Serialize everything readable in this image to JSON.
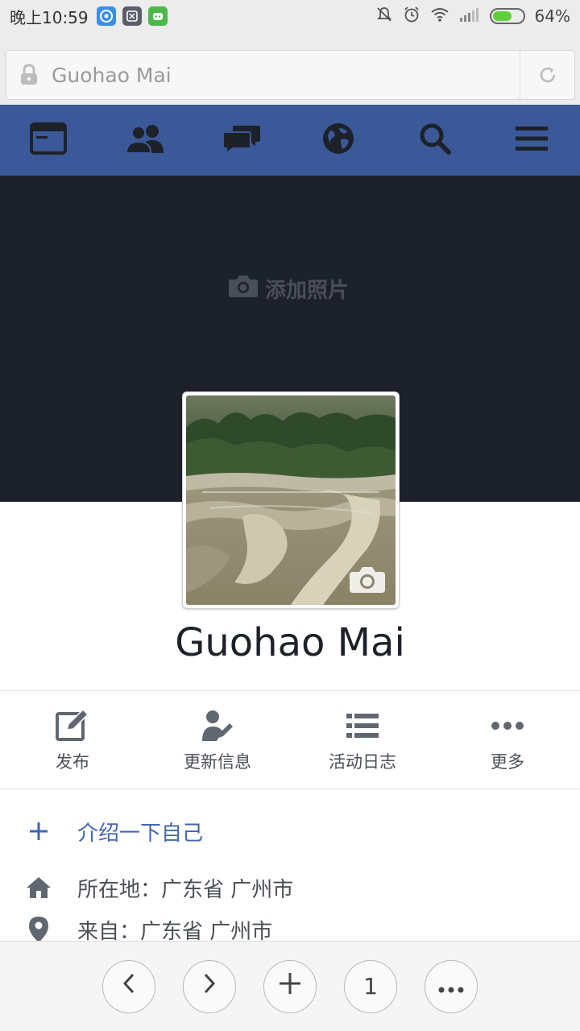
{
  "status_bar": {
    "time": "晚上10:59",
    "battery_percent": "64%",
    "battery_level": 0.64
  },
  "address_bar": {
    "url_text": "Guohao Mai"
  },
  "fb_nav": {
    "items": [
      "news-feed-icon",
      "friends-icon",
      "messages-icon",
      "notifications-globe-icon",
      "search-icon",
      "menu-icon"
    ]
  },
  "cover": {
    "add_photo_label": "添加照片"
  },
  "profile": {
    "name": "Guohao Mai"
  },
  "actions": [
    {
      "label": "发布",
      "icon": "edit-icon"
    },
    {
      "label": "更新信息",
      "icon": "update-info-icon"
    },
    {
      "label": "活动日志",
      "icon": "list-icon"
    },
    {
      "label": "更多",
      "icon": "more-icon"
    }
  ],
  "about": {
    "intro_label": "介绍一下自己",
    "location": "所在地：广东省 广州市",
    "from": "来自：广东省 广州市"
  },
  "bottom_bar": {
    "tab_count": "1"
  },
  "colors": {
    "fb_blue": "#3b5998",
    "link_blue": "#4267b2",
    "cover_bg": "#1d212b"
  }
}
